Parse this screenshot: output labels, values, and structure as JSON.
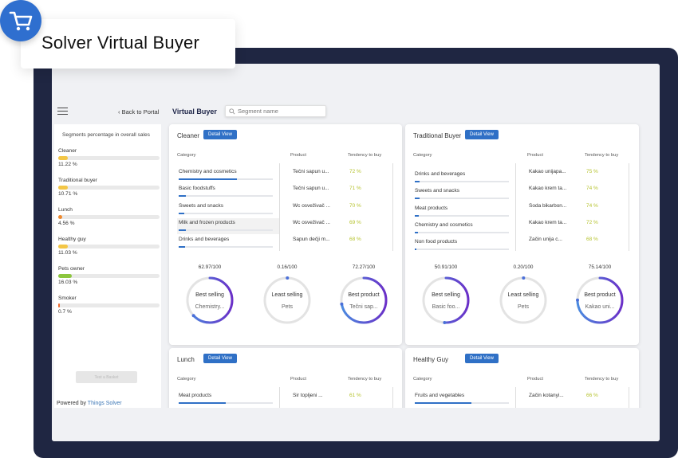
{
  "brand": {
    "title": "Solver Virtual Buyer",
    "accent": "#2f6fcf"
  },
  "topbar": {
    "back_label": "Back to Portal",
    "page_title": "Virtual Buyer",
    "search_placeholder": "Segment name"
  },
  "sidebar": {
    "title": "Segments percentage in overall sales",
    "segments": [
      {
        "name": "Cleaner",
        "percent_label": "11.22 %",
        "fill": 0.1122,
        "color": "#f3c646"
      },
      {
        "name": "Traditional buyer",
        "percent_label": "10.71 %",
        "fill": 0.1071,
        "color": "#f3c646"
      },
      {
        "name": "Lunch",
        "percent_label": "4.56 %",
        "fill": 0.0456,
        "color": "#ef8a2f"
      },
      {
        "name": "Healthy guy",
        "percent_label": "11.03 %",
        "fill": 0.1103,
        "color": "#f3c646"
      },
      {
        "name": "Pets owner",
        "percent_label": "16.03 %",
        "fill": 0.1603,
        "color": "#8cc63e"
      },
      {
        "name": "Smoker",
        "percent_label": "0.7 %",
        "fill": 0.007,
        "color": "#ef6b2f"
      }
    ],
    "button_label": "Test a Basket",
    "powered_prefix": "Powered by ",
    "powered_link": "Things Solver"
  },
  "headers": {
    "category": "Category",
    "product": "Product",
    "tendency": "Tendency to buy",
    "detail": "Detail View"
  },
  "cards": [
    {
      "title": "Cleaner",
      "categories": [
        {
          "name": "Chemistry and cosmetics",
          "fill": 0.62
        },
        {
          "name": "Basic foodstuffs",
          "fill": 0.08
        },
        {
          "name": "Sweets and snacks",
          "fill": 0.06
        },
        {
          "name": "Milk and frozen products",
          "fill": 0.08
        },
        {
          "name": "Drinks and beverages",
          "fill": 0.07
        }
      ],
      "products": [
        "Tečni sapun u...",
        "Tečni sapun u...",
        "Wc osveživač ...",
        "Wc osveživač ...",
        "Sapun dečji m..."
      ],
      "tendency": [
        "72 %",
        "71 %",
        "70 %",
        "69 %",
        "68 %"
      ],
      "gauges": [
        {
          "value": "62.97/100",
          "fill": 0.6297,
          "label": "Best selling",
          "sub": "Chemistry..."
        },
        {
          "value": "0.16/100",
          "fill": 0.0016,
          "label": "Least selling",
          "sub": "Pets"
        },
        {
          "value": "72.27/100",
          "fill": 0.7227,
          "label": "Best product",
          "sub": "Tečni sap..."
        }
      ]
    },
    {
      "title": "Traditional Buyer",
      "categories": [
        {
          "name": "Drinks and beverages",
          "fill": 0.05
        },
        {
          "name": "Sweets and snacks",
          "fill": 0.05
        },
        {
          "name": "Meat products",
          "fill": 0.04
        },
        {
          "name": "Chemistry and cosmetics",
          "fill": 0.03
        },
        {
          "name": "Non food products",
          "fill": 0.02
        }
      ],
      "products": [
        "Kakao unijapa...",
        "Kakao krem ta...",
        "Soda bikarbon...",
        "Kakao krem ta...",
        "Začin unija c..."
      ],
      "tendency": [
        "75 %",
        "74 %",
        "74 %",
        "72 %",
        "68 %"
      ],
      "gauges": [
        {
          "value": "50.91/100",
          "fill": 0.5091,
          "label": "Best selling",
          "sub": "Basic foo..."
        },
        {
          "value": "0.20/100",
          "fill": 0.002,
          "label": "Least selling",
          "sub": "Pets"
        },
        {
          "value": "75.14/100",
          "fill": 0.7514,
          "label": "Best product",
          "sub": "Kakao uni..."
        }
      ]
    },
    {
      "title": "Lunch",
      "categories": [
        {
          "name": "Meat products",
          "fill": 0.5
        }
      ],
      "products": [
        "Sir topljeni ..."
      ],
      "tendency": [
        "61 %"
      ],
      "gauges": []
    },
    {
      "title": "Healthy Guy",
      "categories": [
        {
          "name": "Fruits and vegetables",
          "fill": 0.6
        }
      ],
      "products": [
        "Začin kotanyi..."
      ],
      "tendency": [
        "66 %"
      ],
      "gauges": []
    }
  ]
}
